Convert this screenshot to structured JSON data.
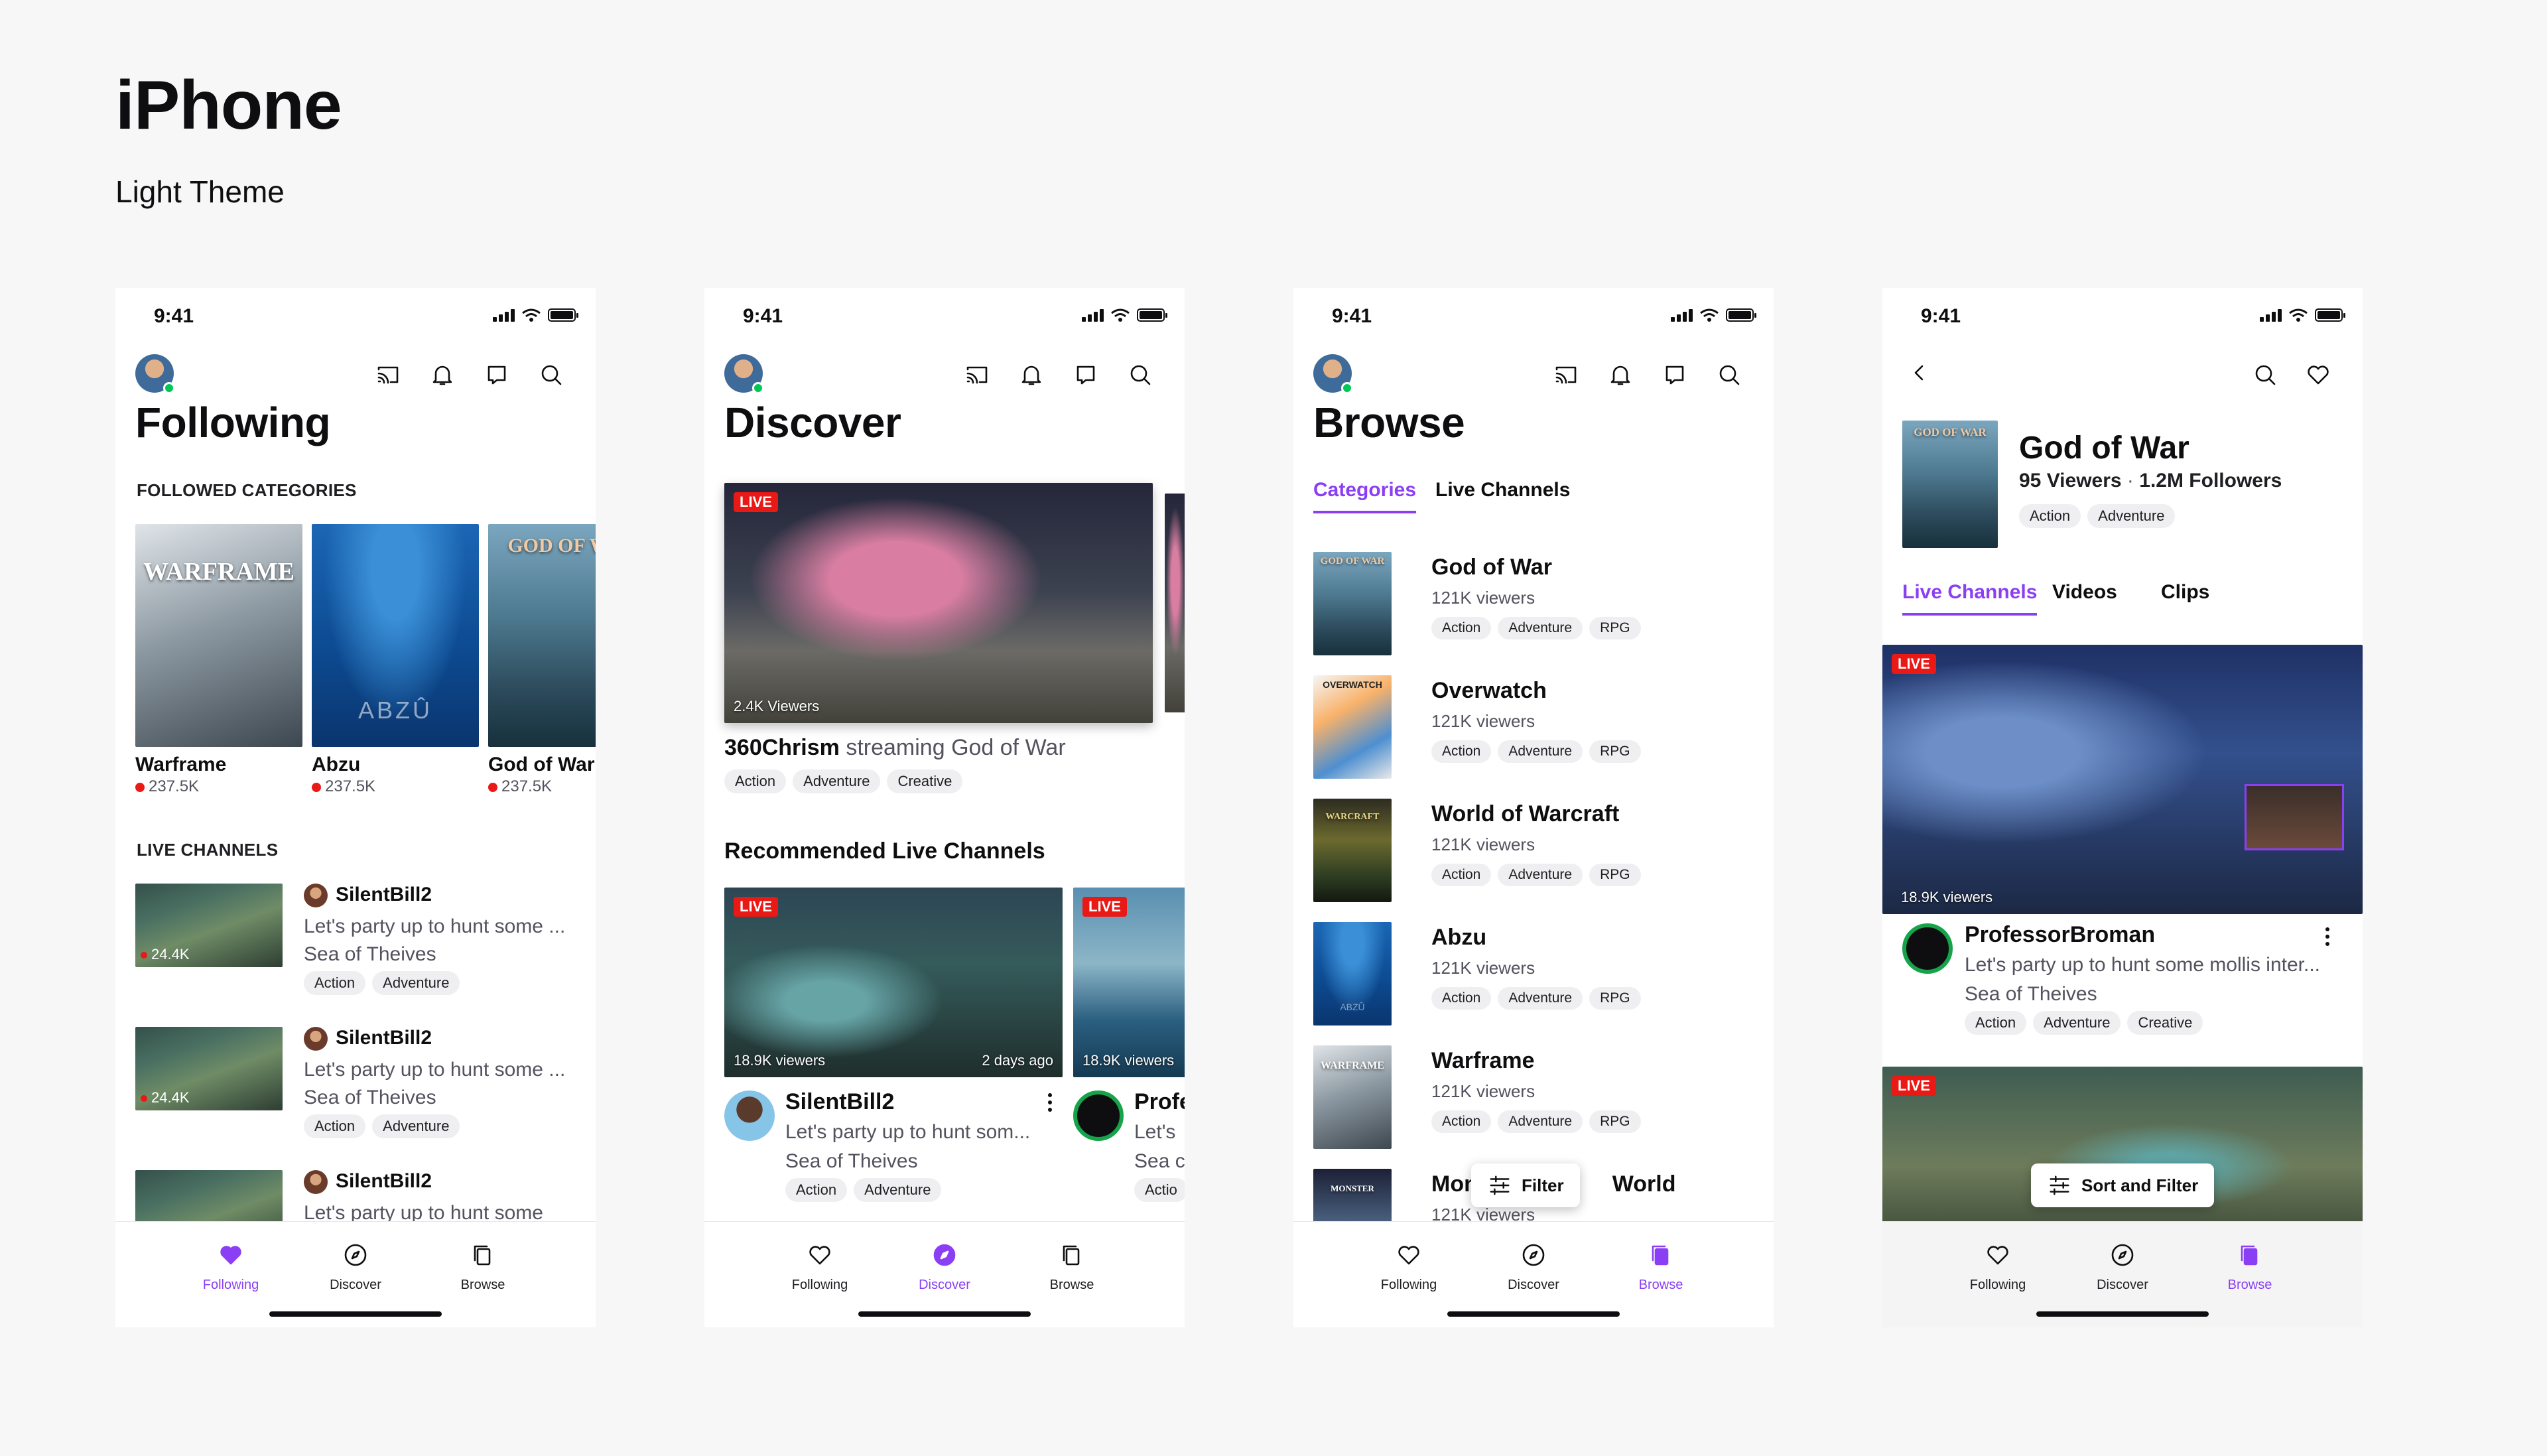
{
  "header": {
    "title": "iPhone",
    "subtitle": "Light Theme"
  },
  "status": {
    "time": "9:41"
  },
  "tabbar": {
    "following": "Following",
    "discover": "Discover",
    "browse": "Browse"
  },
  "colors": {
    "accent": "#8b3ff5",
    "live": "#e91916",
    "online": "#00c853"
  },
  "icons": [
    "cast-icon",
    "bell-icon",
    "inbox-icon",
    "search-icon",
    "heart-icon",
    "compass-icon",
    "browse-icon",
    "back-icon",
    "filter-icon"
  ],
  "following": {
    "title": "Following",
    "followed_label": "FOLLOWED CATEGORIES",
    "categories": [
      {
        "name": "Warframe",
        "viewers": "237.5K",
        "cover": "WARFRAME"
      },
      {
        "name": "Abzu",
        "viewers": "237.5K",
        "cover": "ABZÛ"
      },
      {
        "name": "God of War",
        "viewers": "237.5K",
        "cover": "GOD OF WAR"
      }
    ],
    "live_label": "LIVE CHANNELS",
    "channels": [
      {
        "name": "SilentBill2",
        "viewers": "24.4K",
        "desc1": "Let's party up to hunt some ...",
        "desc2": "Sea of Theives",
        "tags": [
          "Action",
          "Adventure"
        ]
      },
      {
        "name": "SilentBill2",
        "viewers": "24.4K",
        "desc1": "Let's party up to hunt some ...",
        "desc2": "Sea of Theives",
        "tags": [
          "Action",
          "Adventure"
        ]
      },
      {
        "name": "SilentBill2",
        "viewers": "",
        "desc1": "Let's party up to hunt some",
        "desc2": "",
        "tags": []
      }
    ]
  },
  "discover": {
    "title": "Discover",
    "hero": {
      "live": "LIVE",
      "viewers": "2.4K Viewers",
      "streamer": "360Chrism",
      "streaming_word": "streaming",
      "game": "God of War",
      "tags": [
        "Action",
        "Adventure",
        "Creative"
      ]
    },
    "recommended_label": "Recommended Live Channels",
    "cards": [
      {
        "live": "LIVE",
        "viewers": "18.9K viewers",
        "ago": "2 days ago",
        "name": "SilentBill2",
        "desc1": "Let's party up to hunt som...",
        "desc2": "Sea of Theives",
        "tags": [
          "Action",
          "Adventure"
        ]
      },
      {
        "live": "LIVE",
        "viewers": "18.9K viewers",
        "name": "Profe",
        "desc1": "Let's",
        "desc2": "Sea c",
        "tags": [
          "Actio"
        ]
      }
    ]
  },
  "browse": {
    "title": "Browse",
    "tabs": [
      "Categories",
      "Live Channels"
    ],
    "rows": [
      {
        "name": "God of War",
        "viewers": "121K viewers",
        "tags": [
          "Action",
          "Adventure",
          "RPG"
        ],
        "cover": "GOD OF WAR"
      },
      {
        "name": "Overwatch",
        "viewers": "121K viewers",
        "tags": [
          "Action",
          "Adventure",
          "RPG"
        ],
        "cover": "OVERWATCH"
      },
      {
        "name": "World of Warcraft",
        "viewers": "121K viewers",
        "tags": [
          "Action",
          "Adventure",
          "RPG"
        ],
        "cover": "WARCRAFT"
      },
      {
        "name": "Abzu",
        "viewers": "121K viewers",
        "tags": [
          "Action",
          "Adventure",
          "RPG"
        ],
        "cover": "ABZÛ"
      },
      {
        "name": "Warframe",
        "viewers": "121K viewers",
        "tags": [
          "Action",
          "Adventure",
          "RPG"
        ],
        "cover": "WARFRAME"
      },
      {
        "name_left": "Mons",
        "name_right": "World",
        "viewers": "121K viewers",
        "tags": [],
        "cover": "MONSTER"
      }
    ],
    "filter_label": "Filter"
  },
  "game": {
    "title": "God of War",
    "viewers": "95 Viewers",
    "separator": "·",
    "followers": "1.2M Followers",
    "tags": [
      "Action",
      "Adventure"
    ],
    "cover": "GOD OF WAR",
    "tabs": [
      "Live Channels",
      "Videos",
      "Clips"
    ],
    "stream1": {
      "live": "LIVE",
      "viewers": "18.9K viewers",
      "name": "ProfessorBroman",
      "desc1": "Let's party up to hunt some mollis inter...",
      "desc2": "Sea of Theives",
      "tags": [
        "Action",
        "Adventure",
        "Creative"
      ]
    },
    "stream2": {
      "live": "LIVE"
    },
    "sort_label": "Sort and Filter"
  }
}
